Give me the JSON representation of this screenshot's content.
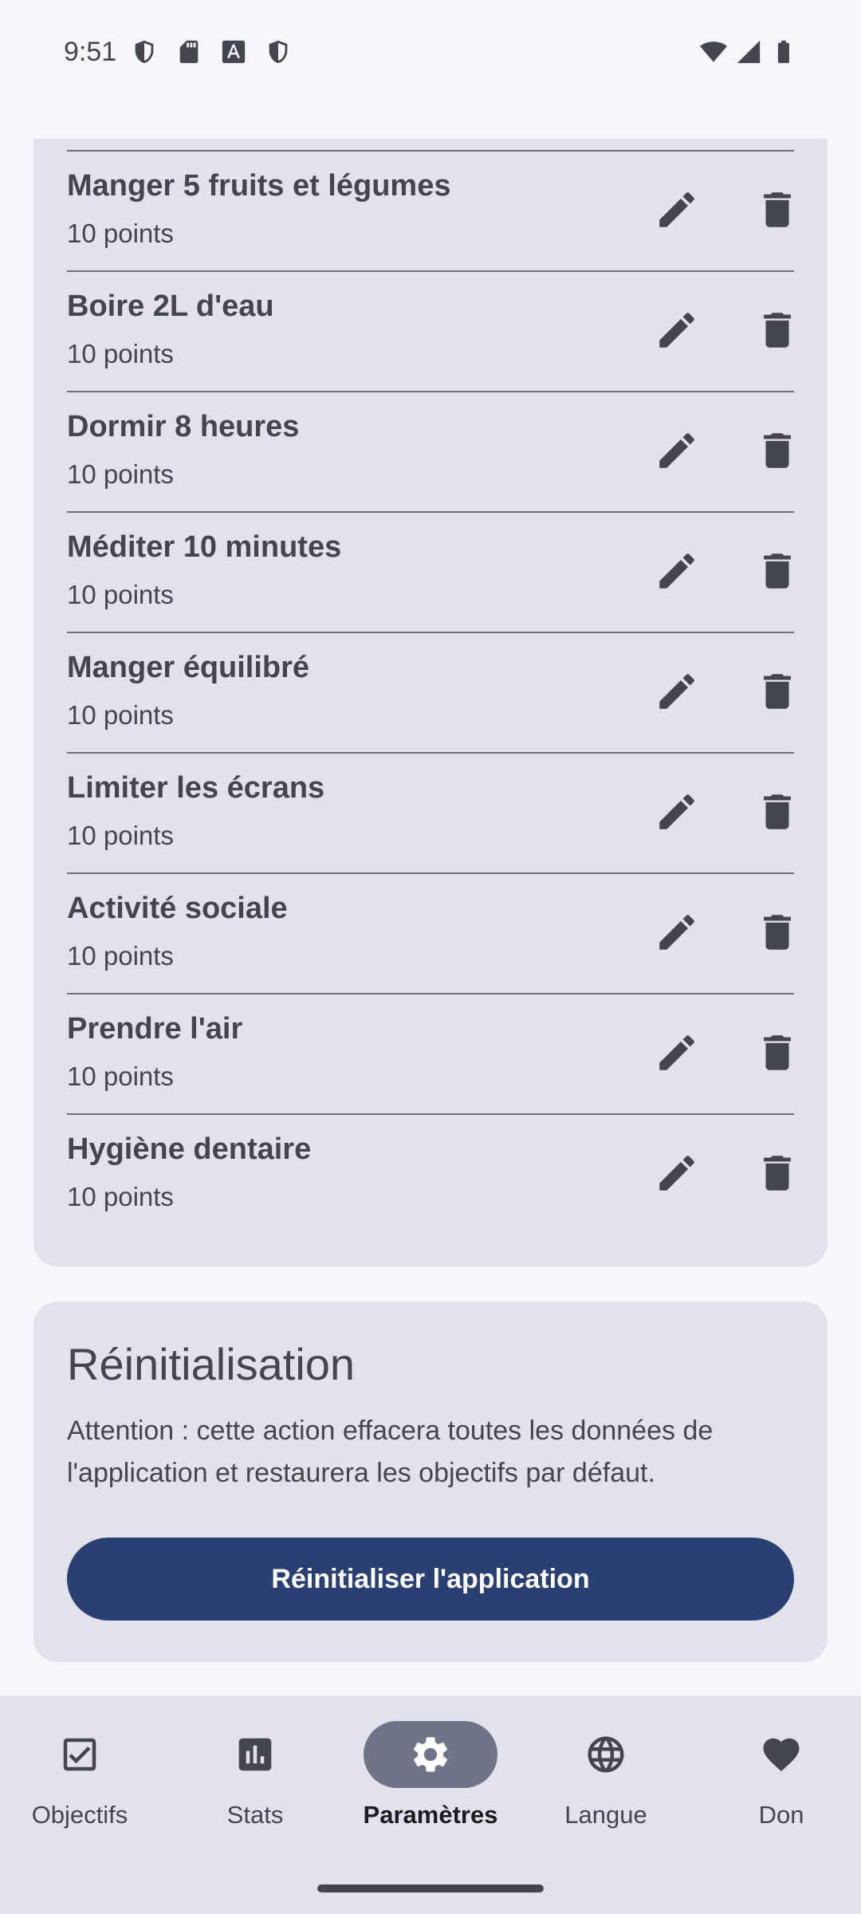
{
  "status_bar": {
    "time": "9:51",
    "left_icons": [
      "shield-icon",
      "sd-card-icon",
      "font-download-icon",
      "shield-icon"
    ],
    "right_icons": [
      "wifi-icon",
      "signal-icon",
      "battery-icon"
    ]
  },
  "goals": [
    {
      "title": "Manger 5 fruits et légumes",
      "points": "10 points"
    },
    {
      "title": "Boire 2L d'eau",
      "points": "10 points"
    },
    {
      "title": "Dormir 8 heures",
      "points": "10 points"
    },
    {
      "title": "Méditer 10 minutes",
      "points": "10 points"
    },
    {
      "title": "Manger équilibré",
      "points": "10 points"
    },
    {
      "title": "Limiter les écrans",
      "points": "10 points"
    },
    {
      "title": "Activité sociale",
      "points": "10 points"
    },
    {
      "title": "Prendre l'air",
      "points": "10 points"
    },
    {
      "title": "Hygiène dentaire",
      "points": "10 points"
    }
  ],
  "reset": {
    "title": "Réinitialisation",
    "description": "Attention : cette action effacera toutes les données de l'application et restaurera les objectifs par défaut.",
    "button_label": "Réinitialiser l'application"
  },
  "nav": {
    "items": [
      {
        "label": "Objectifs",
        "icon": "check-box-icon"
      },
      {
        "label": "Stats",
        "icon": "bar-chart-icon"
      },
      {
        "label": "Paramètres",
        "icon": "gear-icon",
        "active": true
      },
      {
        "label": "Langue",
        "icon": "globe-icon"
      },
      {
        "label": "Don",
        "icon": "heart-icon"
      }
    ]
  },
  "colors": {
    "background": "#f7f6fc",
    "card": "#e2e2ea",
    "primary_button": "#2a4072",
    "active_nav_pill": "#6f7488",
    "text": "#44464f"
  }
}
